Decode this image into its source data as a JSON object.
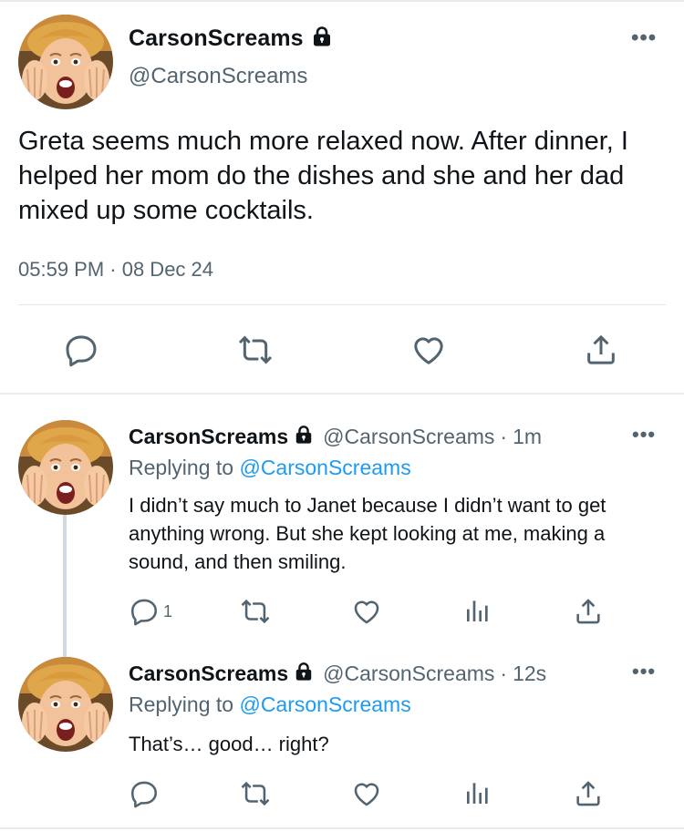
{
  "main_tweet": {
    "display_name": "CarsonScreams",
    "handle": "@CarsonScreams",
    "text": "Greta seems much more relaxed now. After dinner, I helped her mom do the dishes and she and her dad mixed up some cocktails.",
    "timestamp": "05:59 PM · 08 Dec 24",
    "actions": [
      "reply-icon",
      "retweet-icon",
      "like-icon",
      "share-icon"
    ]
  },
  "replies": [
    {
      "display_name": "CarsonScreams",
      "handle": "@CarsonScreams",
      "dot": "·",
      "time": "1m",
      "replying_prefix": "Replying to",
      "replying_to": "@CarsonScreams",
      "text": "I didn’t say much to Janet because I didn’t want to get anything wrong. But she kept looking at me, making a sound, and then smiling.",
      "reply_count": "1"
    },
    {
      "display_name": "CarsonScreams",
      "handle": "@CarsonScreams",
      "dot": "·",
      "time": "12s",
      "replying_prefix": "Replying to",
      "replying_to": "@CarsonScreams",
      "text": "That’s… good… right?",
      "reply_count": ""
    }
  ],
  "more_label": "•••",
  "colors": {
    "accent": "#1d9bf0",
    "secondary_text": "#536471",
    "primary_text": "#0f1419",
    "divider": "#e6ecf0"
  }
}
